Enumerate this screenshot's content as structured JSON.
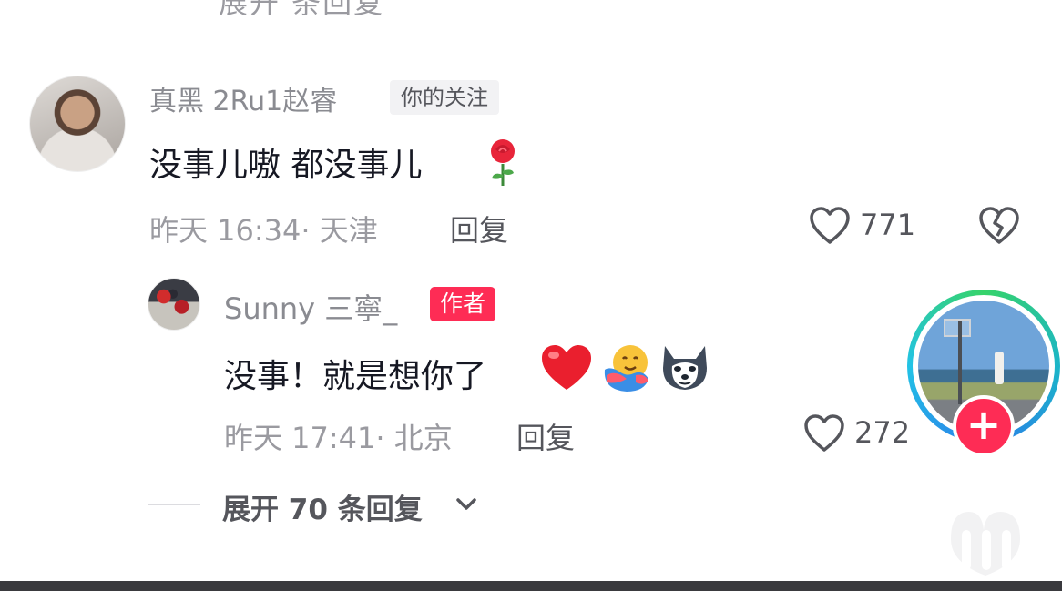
{
  "previous": {
    "cutoff_text": "展开 条回复"
  },
  "comment": {
    "username": "真黑 2Ru1赵睿",
    "follow_tag": "你的关注",
    "text": "没事儿嗷 都没事儿",
    "emoji": "rose-icon",
    "meta": "昨天 16:34· 天津",
    "reply_label": "回复",
    "likes": "771"
  },
  "reply": {
    "username": "Sunny 三寧_",
    "author_tag": "作者",
    "text": "没事！就是想你了",
    "emojis": [
      "red-heart-icon",
      "hug-face-icon",
      "husky-dog-icon"
    ],
    "meta": "昨天 17:41· 北京",
    "reply_label": "回复",
    "likes": "272"
  },
  "expand": {
    "label": "展开 70 条回复"
  },
  "colors": {
    "accent": "#fe2c55",
    "muted": "#9a9aa0",
    "text": "#161823",
    "ring": "#2b7de9"
  }
}
